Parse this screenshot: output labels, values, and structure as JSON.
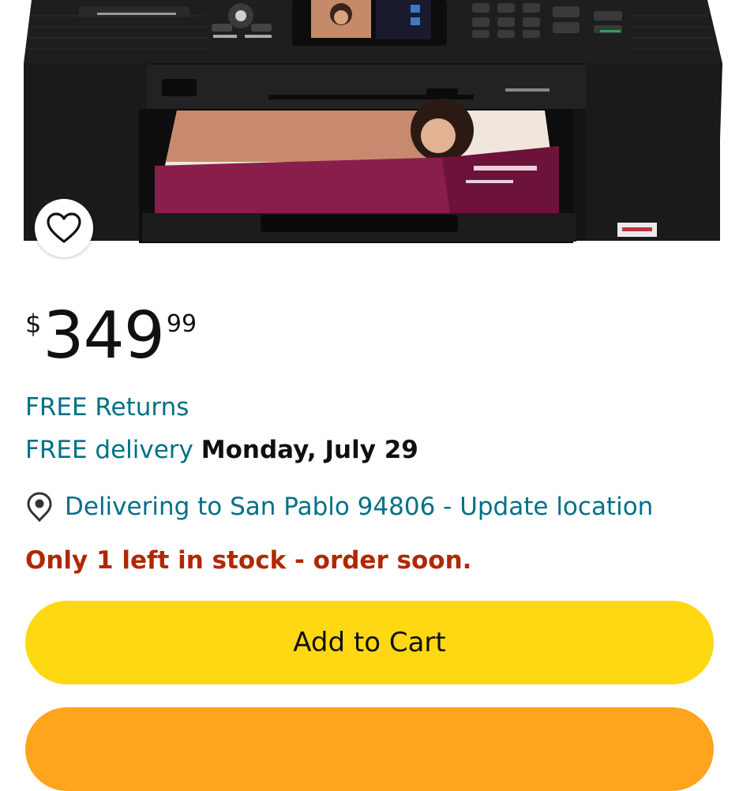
{
  "product": {
    "image_alt": "Inkjet all-in-one printer"
  },
  "price": {
    "symbol": "$",
    "whole": "349",
    "fraction": "99"
  },
  "returns": {
    "label": "FREE Returns"
  },
  "delivery": {
    "label": "FREE delivery",
    "date": "Monday, July 29"
  },
  "location": {
    "icon": "location-pin-icon",
    "text": "Delivering to San Pablo 94806 - Update location"
  },
  "stock": {
    "text": "Only 1 left in stock - order soon."
  },
  "actions": {
    "add_to_cart": "Add to Cart",
    "buy_now": ""
  },
  "colors": {
    "link": "#007185",
    "stock_warning": "#b12704",
    "add_to_cart": "#ffd814",
    "buy_now": "#ffa41c"
  }
}
